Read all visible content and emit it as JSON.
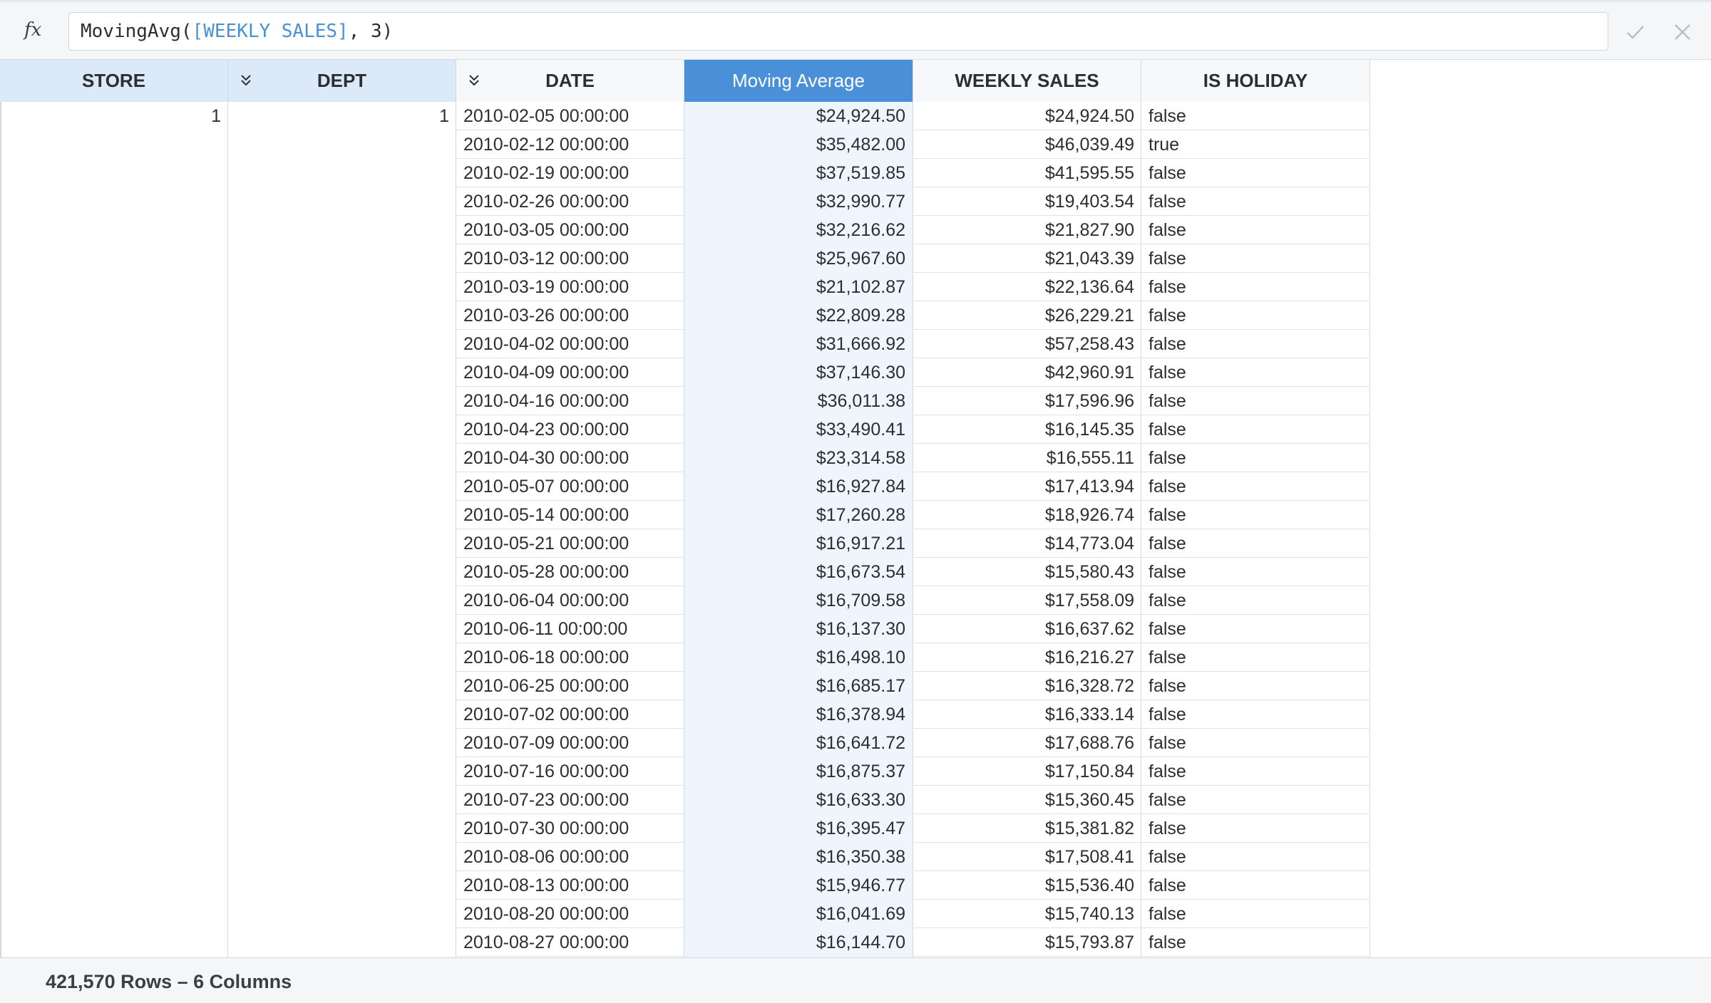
{
  "formula": {
    "fx_label": "fx",
    "func_open": "MovingAvg(",
    "arg": "[WEEKLY SALES]",
    "rest": ", 3)",
    "confirm_icon": "check-icon",
    "cancel_icon": "close-icon"
  },
  "columns": [
    {
      "label": "STORE",
      "style": "index"
    },
    {
      "label": "DEPT",
      "style": "index",
      "collapse_icon": "chevrons-down-icon"
    },
    {
      "label": "DATE",
      "style": "plain",
      "collapse_icon": "chevrons-down-icon"
    },
    {
      "label": "Moving Average",
      "style": "selected"
    },
    {
      "label": "WEEKLY SALES",
      "style": "plain"
    },
    {
      "label": "IS HOLIDAY",
      "style": "plain"
    }
  ],
  "index_values": {
    "store": "1",
    "dept": "1"
  },
  "rows": [
    {
      "date": "2010-02-05 00:00:00",
      "moving_avg": "$24,924.50",
      "weekly_sales": "$24,924.50",
      "is_holiday": "false"
    },
    {
      "date": "2010-02-12 00:00:00",
      "moving_avg": "$35,482.00",
      "weekly_sales": "$46,039.49",
      "is_holiday": "true"
    },
    {
      "date": "2010-02-19 00:00:00",
      "moving_avg": "$37,519.85",
      "weekly_sales": "$41,595.55",
      "is_holiday": "false"
    },
    {
      "date": "2010-02-26 00:00:00",
      "moving_avg": "$32,990.77",
      "weekly_sales": "$19,403.54",
      "is_holiday": "false"
    },
    {
      "date": "2010-03-05 00:00:00",
      "moving_avg": "$32,216.62",
      "weekly_sales": "$21,827.90",
      "is_holiday": "false"
    },
    {
      "date": "2010-03-12 00:00:00",
      "moving_avg": "$25,967.60",
      "weekly_sales": "$21,043.39",
      "is_holiday": "false"
    },
    {
      "date": "2010-03-19 00:00:00",
      "moving_avg": "$21,102.87",
      "weekly_sales": "$22,136.64",
      "is_holiday": "false"
    },
    {
      "date": "2010-03-26 00:00:00",
      "moving_avg": "$22,809.28",
      "weekly_sales": "$26,229.21",
      "is_holiday": "false"
    },
    {
      "date": "2010-04-02 00:00:00",
      "moving_avg": "$31,666.92",
      "weekly_sales": "$57,258.43",
      "is_holiday": "false"
    },
    {
      "date": "2010-04-09 00:00:00",
      "moving_avg": "$37,146.30",
      "weekly_sales": "$42,960.91",
      "is_holiday": "false"
    },
    {
      "date": "2010-04-16 00:00:00",
      "moving_avg": "$36,011.38",
      "weekly_sales": "$17,596.96",
      "is_holiday": "false"
    },
    {
      "date": "2010-04-23 00:00:00",
      "moving_avg": "$33,490.41",
      "weekly_sales": "$16,145.35",
      "is_holiday": "false"
    },
    {
      "date": "2010-04-30 00:00:00",
      "moving_avg": "$23,314.58",
      "weekly_sales": "$16,555.11",
      "is_holiday": "false"
    },
    {
      "date": "2010-05-07 00:00:00",
      "moving_avg": "$16,927.84",
      "weekly_sales": "$17,413.94",
      "is_holiday": "false"
    },
    {
      "date": "2010-05-14 00:00:00",
      "moving_avg": "$17,260.28",
      "weekly_sales": "$18,926.74",
      "is_holiday": "false"
    },
    {
      "date": "2010-05-21 00:00:00",
      "moving_avg": "$16,917.21",
      "weekly_sales": "$14,773.04",
      "is_holiday": "false"
    },
    {
      "date": "2010-05-28 00:00:00",
      "moving_avg": "$16,673.54",
      "weekly_sales": "$15,580.43",
      "is_holiday": "false"
    },
    {
      "date": "2010-06-04 00:00:00",
      "moving_avg": "$16,709.58",
      "weekly_sales": "$17,558.09",
      "is_holiday": "false"
    },
    {
      "date": "2010-06-11 00:00:00",
      "moving_avg": "$16,137.30",
      "weekly_sales": "$16,637.62",
      "is_holiday": "false"
    },
    {
      "date": "2010-06-18 00:00:00",
      "moving_avg": "$16,498.10",
      "weekly_sales": "$16,216.27",
      "is_holiday": "false"
    },
    {
      "date": "2010-06-25 00:00:00",
      "moving_avg": "$16,685.17",
      "weekly_sales": "$16,328.72",
      "is_holiday": "false"
    },
    {
      "date": "2010-07-02 00:00:00",
      "moving_avg": "$16,378.94",
      "weekly_sales": "$16,333.14",
      "is_holiday": "false"
    },
    {
      "date": "2010-07-09 00:00:00",
      "moving_avg": "$16,641.72",
      "weekly_sales": "$17,688.76",
      "is_holiday": "false"
    },
    {
      "date": "2010-07-16 00:00:00",
      "moving_avg": "$16,875.37",
      "weekly_sales": "$17,150.84",
      "is_holiday": "false"
    },
    {
      "date": "2010-07-23 00:00:00",
      "moving_avg": "$16,633.30",
      "weekly_sales": "$15,360.45",
      "is_holiday": "false"
    },
    {
      "date": "2010-07-30 00:00:00",
      "moving_avg": "$16,395.47",
      "weekly_sales": "$15,381.82",
      "is_holiday": "false"
    },
    {
      "date": "2010-08-06 00:00:00",
      "moving_avg": "$16,350.38",
      "weekly_sales": "$17,508.41",
      "is_holiday": "false"
    },
    {
      "date": "2010-08-13 00:00:00",
      "moving_avg": "$15,946.77",
      "weekly_sales": "$15,536.40",
      "is_holiday": "false"
    },
    {
      "date": "2010-08-20 00:00:00",
      "moving_avg": "$16,041.69",
      "weekly_sales": "$15,740.13",
      "is_holiday": "false"
    },
    {
      "date": "2010-08-27 00:00:00",
      "moving_avg": "$16,144.70",
      "weekly_sales": "$15,793.87",
      "is_holiday": "false"
    }
  ],
  "status": {
    "summary": "421,570 Rows – 6 Columns"
  },
  "colors": {
    "selected_header": "#4a90d9",
    "index_header": "#dbe9f8",
    "selected_column_fill": "#eef5fd",
    "formula_arg": "#4a90d9"
  }
}
